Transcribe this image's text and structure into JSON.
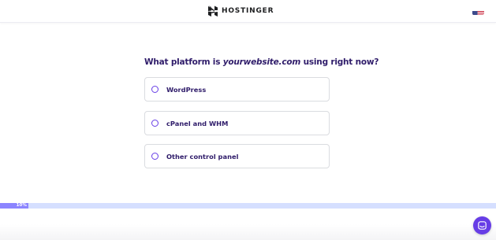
{
  "header": {
    "brand": "HOSTINGER",
    "language_flag_icon": "us-flag-icon"
  },
  "question": {
    "prefix": "What platform is ",
    "domain": "yourwebsite.com",
    "suffix": " using right now?"
  },
  "options": [
    {
      "label": "WordPress"
    },
    {
      "label": "cPanel and WHM"
    },
    {
      "label": "Other control panel"
    }
  ],
  "progress": {
    "label": "10%",
    "fraction": 0.057
  },
  "chat": {
    "icon": "chat-icon"
  },
  "colors": {
    "accent": "#673de6",
    "text": "#2f1c6a",
    "progress_track": "#d5dfff",
    "progress_fill": "#8c85ff"
  }
}
